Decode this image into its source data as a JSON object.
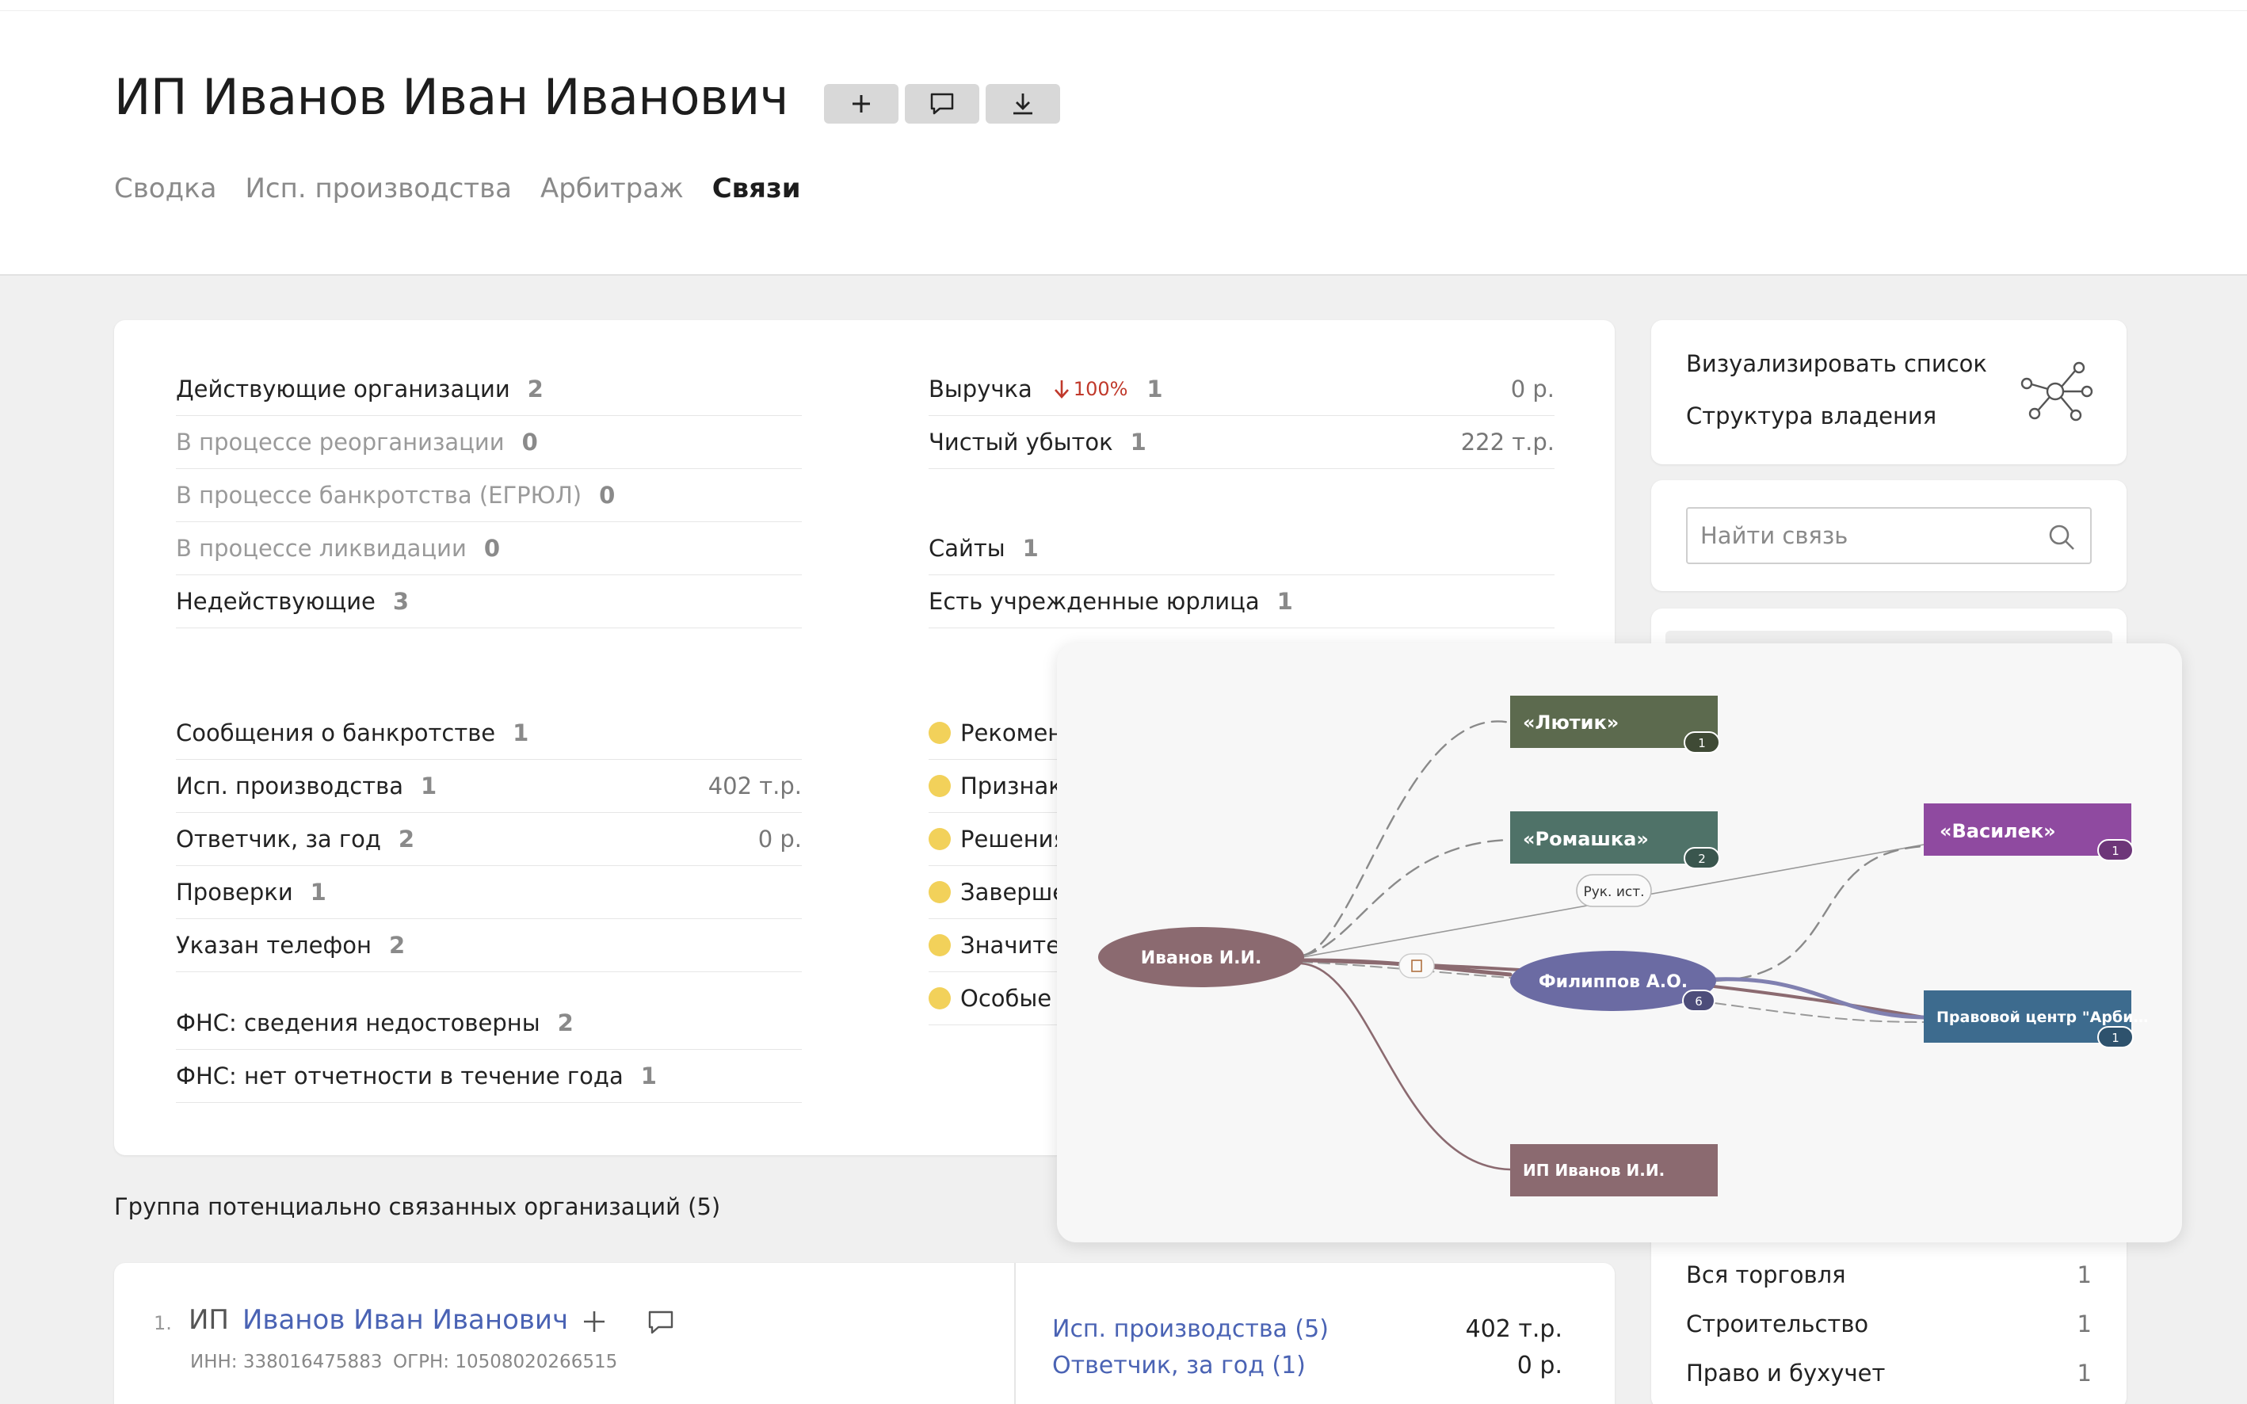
{
  "header": {
    "title": "ИП Иванов Иван Иванович",
    "tabs": [
      {
        "label": "Сводка",
        "active": false
      },
      {
        "label": "Исп. производства",
        "active": false
      },
      {
        "label": "Арбитраж",
        "active": false
      },
      {
        "label": "Связи",
        "active": true
      }
    ]
  },
  "stats_left": [
    {
      "label": "Действующие организации",
      "count": "2",
      "muted": false
    },
    {
      "label": "В процессе реорганизации",
      "count": "0",
      "muted": true
    },
    {
      "label": "В процессе банкротства (ЕГРЮЛ)",
      "count": "0",
      "muted": true
    },
    {
      "label": "В процессе ликвидации",
      "count": "0",
      "muted": true
    },
    {
      "label": "Недействующие",
      "count": "3",
      "muted": false
    }
  ],
  "stats_left2": [
    {
      "label": "Сообщения о банкротстве",
      "count": "1",
      "value": ""
    },
    {
      "label": "Исп. производства",
      "count": "1",
      "value": "402 т.р."
    },
    {
      "label": "Ответчик, за год",
      "count": "2",
      "value": "0 р."
    },
    {
      "label": "Проверки",
      "count": "1",
      "value": ""
    },
    {
      "label": "Указан телефон",
      "count": "2",
      "value": ""
    }
  ],
  "stats_left3": [
    {
      "label": "ФНС: сведения недостоверны",
      "count": "2"
    },
    {
      "label": "ФНС: нет отчетности в течение года",
      "count": "1"
    }
  ],
  "stats_right": {
    "revenue": {
      "label": "Выручка",
      "trend": "100%",
      "count": "1",
      "value": "0 р."
    },
    "loss": {
      "label": "Чистый убыток",
      "count": "1",
      "value": "222 т.р."
    },
    "sites": {
      "label": "Сайты",
      "count": "1"
    },
    "founded": {
      "label": "Есть учрежденные юрлица",
      "count": "1"
    }
  },
  "flags": [
    "Рекомен",
    "Признак",
    "Решения",
    "Заверше",
    "Значител",
    "Особые г"
  ],
  "sidebar": {
    "visualize": "Визуализировать список",
    "ownership": "Структура владения",
    "search_placeholder": "Найти связь",
    "filters": [
      {
        "label": "Вся торговля",
        "count": "1"
      },
      {
        "label": "Строительство",
        "count": "1"
      },
      {
        "label": "Право и бухучет",
        "count": "1"
      }
    ]
  },
  "graph": {
    "nodes": {
      "ivanov": "Иванов И.И.",
      "filippov": "Филиппов А.О.",
      "lyutik": "«Лютик»",
      "romashka": "«Ромашка»",
      "vasilek": "«Василек»",
      "pravo": "Правовой центр \"Арби…",
      "ip": "ИП Иванов И.И.",
      "edge_label": "Рук. ист."
    },
    "badges": {
      "lyutik": "1",
      "romashka": "2",
      "vasilek": "1",
      "pravo": "1",
      "filippov": "6"
    },
    "colors": {
      "ivanov": "#8b6a70",
      "filippov": "#6b6ba3",
      "lyutik": "#5c6a4e",
      "romashka": "#4f7268",
      "vasilek": "#8f4aa0",
      "pravo": "#3d6b8e",
      "ip": "#8b6a70"
    }
  },
  "group": {
    "title": "Группа потенциально связанных организаций (5)",
    "item": {
      "index": "1.",
      "prefix": "ИП",
      "name": "Иванов Иван Иванович",
      "inn": "ИНН: 338016475883",
      "ogrn": "ОГРН: 10508020266515",
      "links": [
        {
          "label": "Исп. производства (5)",
          "value": "402 т.р."
        },
        {
          "label": "Ответчик, за год (1)",
          "value": "0 р."
        }
      ]
    }
  }
}
